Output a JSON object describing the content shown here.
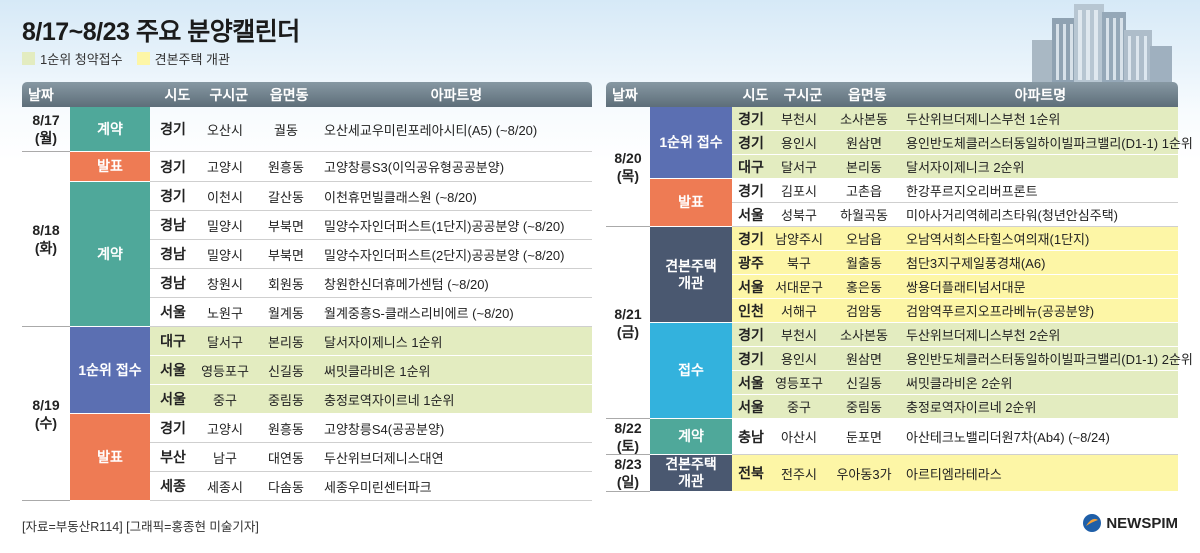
{
  "title": "8/17~8/23 주요 분양캘린더",
  "legend": [
    {
      "label": "1순위 청약접수",
      "color": "#e3ecc0"
    },
    {
      "label": "견본주택 개관",
      "color": "#fdf6a6"
    }
  ],
  "headers": {
    "date": "날짜",
    "sido": "시도",
    "gu": "구시군",
    "dong": "읍면동",
    "apt": "아파트명"
  },
  "colors": {
    "contract": "#4fa89a",
    "announce": "#ee7b54",
    "first": "#5b6fb2",
    "model": "#4a5870",
    "receive": "#33b2dd"
  },
  "left": {
    "dates": [
      {
        "label": "8/17\n(월)"
      },
      {
        "label": "8/18\n(화)"
      },
      {
        "label": "8/19\n(수)"
      }
    ],
    "categories": [
      {
        "label": "계약"
      },
      {
        "label": "발표"
      },
      {
        "label": "계약"
      },
      {
        "label": "1순위 접수"
      },
      {
        "label": "발표"
      }
    ],
    "rows": [
      {
        "sido": "경기",
        "gu": "오산시",
        "dong": "궐동",
        "apt": "오산세교우미린포레아시티(A5) (~8/20)"
      },
      {
        "sido": "경기",
        "gu": "고양시",
        "dong": "원흥동",
        "apt": "고양창릉S3(이익공유형공공분양)"
      },
      {
        "sido": "경기",
        "gu": "이천시",
        "dong": "갈산동",
        "apt": "이천휴먼빌클래스원 (~8/20)"
      },
      {
        "sido": "경남",
        "gu": "밀양시",
        "dong": "부북면",
        "apt": "밀양수자인더퍼스트(1단지)공공분양 (~8/20)"
      },
      {
        "sido": "경남",
        "gu": "밀양시",
        "dong": "부북면",
        "apt": "밀양수자인더퍼스트(2단지)공공분양 (~8/20)"
      },
      {
        "sido": "경남",
        "gu": "창원시",
        "dong": "회원동",
        "apt": "창원한신더휴메가센텀 (~8/20)"
      },
      {
        "sido": "서울",
        "gu": "노원구",
        "dong": "월계동",
        "apt": "월계중흥S-클래스리비에르 (~8/20)"
      },
      {
        "sido": "대구",
        "gu": "달서구",
        "dong": "본리동",
        "apt": "달서자이제니스 1순위"
      },
      {
        "sido": "서울",
        "gu": "영등포구",
        "dong": "신길동",
        "apt": "써밋클라비온 1순위"
      },
      {
        "sido": "서울",
        "gu": "중구",
        "dong": "중림동",
        "apt": "충정로역자이르네 1순위"
      },
      {
        "sido": "경기",
        "gu": "고양시",
        "dong": "원흥동",
        "apt": "고양창릉S4(공공분양)"
      },
      {
        "sido": "부산",
        "gu": "남구",
        "dong": "대연동",
        "apt": "두산위브더제니스대연"
      },
      {
        "sido": "세종",
        "gu": "세종시",
        "dong": "다솜동",
        "apt": "세종우미린센터파크"
      }
    ]
  },
  "right": {
    "dates": [
      {
        "label": "8/20\n(목)"
      },
      {
        "label": "8/21\n(금)"
      },
      {
        "label": "8/22\n(토)"
      },
      {
        "label": "8/23\n(일)"
      }
    ],
    "categories": [
      {
        "label": "1순위 접수"
      },
      {
        "label": "발표"
      },
      {
        "label": "견본주택\n개관"
      },
      {
        "label": "접수"
      },
      {
        "label": "계약"
      },
      {
        "label": "견본주택\n개관"
      }
    ],
    "rows": [
      {
        "sido": "경기",
        "gu": "부천시",
        "dong": "소사본동",
        "apt": "두산위브더제니스부천 1순위"
      },
      {
        "sido": "경기",
        "gu": "용인시",
        "dong": "원삼면",
        "apt": "용인반도체클러스터동일하이빌파크밸리(D1-1) 1순위"
      },
      {
        "sido": "대구",
        "gu": "달서구",
        "dong": "본리동",
        "apt": "달서자이제니크 2순위"
      },
      {
        "sido": "경기",
        "gu": "김포시",
        "dong": "고촌읍",
        "apt": "한강푸르지오리버프론트"
      },
      {
        "sido": "서울",
        "gu": "성북구",
        "dong": "하월곡동",
        "apt": "미아사거리역헤리츠타워(청년안심주택)"
      },
      {
        "sido": "경기",
        "gu": "남양주시",
        "dong": "오남읍",
        "apt": "오남역서희스타힐스여의재(1단지)"
      },
      {
        "sido": "광주",
        "gu": "북구",
        "dong": "월출동",
        "apt": "첨단3지구제일풍경채(A6)"
      },
      {
        "sido": "서울",
        "gu": "서대문구",
        "dong": "홍은동",
        "apt": "쌍용더플래티넘서대문"
      },
      {
        "sido": "인천",
        "gu": "서해구",
        "dong": "검암동",
        "apt": "검암역푸르지오프라베뉴(공공분양)"
      },
      {
        "sido": "경기",
        "gu": "부천시",
        "dong": "소사본동",
        "apt": "두산위브더제니스부천 2순위"
      },
      {
        "sido": "경기",
        "gu": "용인시",
        "dong": "원삼면",
        "apt": "용인반도체클러스터동일하이빌파크밸리(D1-1) 2순위"
      },
      {
        "sido": "서울",
        "gu": "영등포구",
        "dong": "신길동",
        "apt": "써밋클라비온 2순위"
      },
      {
        "sido": "서울",
        "gu": "중구",
        "dong": "중림동",
        "apt": "충정로역자이르네 2순위"
      },
      {
        "sido": "충남",
        "gu": "아산시",
        "dong": "둔포면",
        "apt": "아산테크노밸리더원7차(Ab4) (~8/24)"
      },
      {
        "sido": "전북",
        "gu": "전주시",
        "dong": "우아동3가",
        "apt": "아르티엠라테라스"
      }
    ]
  },
  "source": "[자료=부동산R114] [그래픽=홍종현 미술기자]",
  "logo": "NEWSPIM"
}
